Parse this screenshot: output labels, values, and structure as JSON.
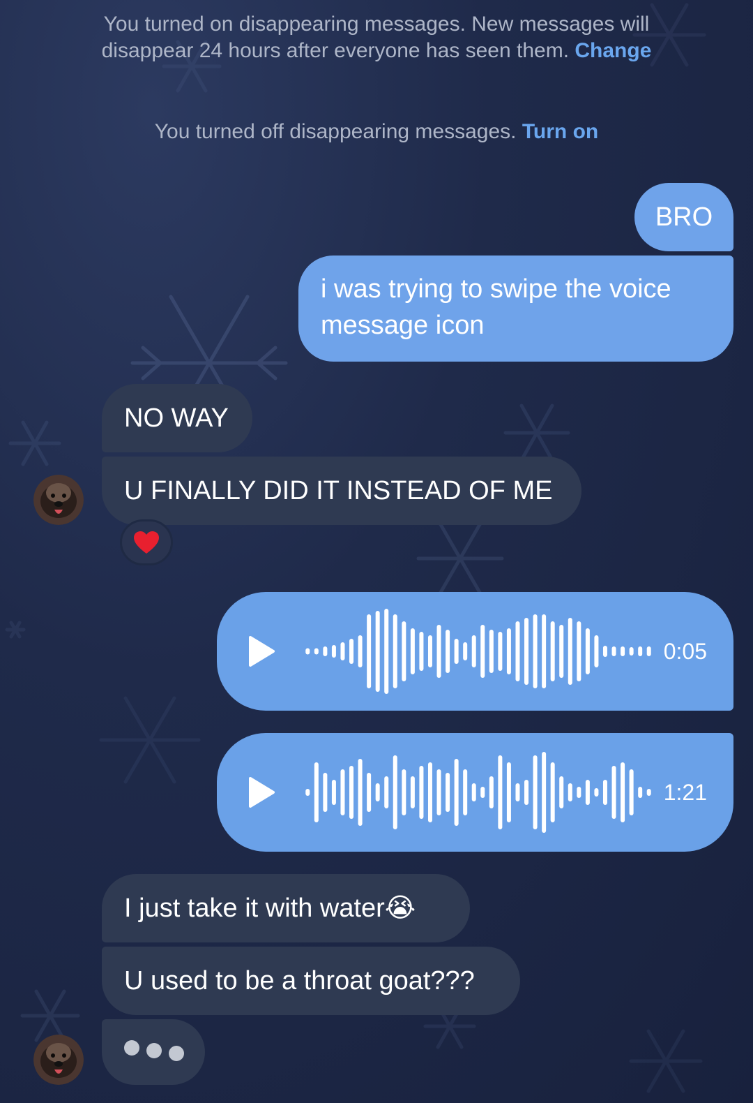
{
  "system_notes": [
    {
      "text": "You turned on disappearing messages. New messages will disappear 24 hours after everyone has seen them.",
      "link": "Change"
    },
    {
      "text": "You turned off disappearing messages.",
      "link": "Turn on"
    }
  ],
  "messages": {
    "out_bro": "BRO",
    "out_swipe": "i was trying to swipe the voice message icon",
    "in_noway": "NO WAY",
    "in_finally": "U FINALLY DID IT INSTEAD OF ME",
    "in_water": "I just take it with water😭",
    "in_throat": "U used to be a throat goat???"
  },
  "reaction": {
    "emoji": "❤️"
  },
  "voice_messages": [
    {
      "duration": "0:05"
    },
    {
      "duration": "1:21"
    }
  ],
  "colors": {
    "outgoing_bubble": "#6fa3ea",
    "incoming_bubble": "#2f3a52",
    "link": "#6aa6ee",
    "background": "#1f2a4a"
  },
  "icons": {
    "play": "play-icon",
    "waveform": "waveform-icon",
    "avatar": "contact-avatar"
  }
}
